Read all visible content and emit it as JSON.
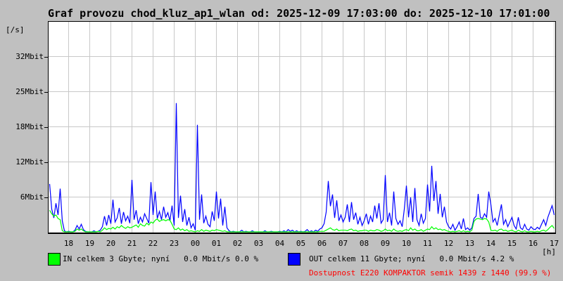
{
  "title": "Graf provozu chod_kluz_ap1_wlan od: 2025-12-09 17:03:00 do: 2025-12-10 17:01:00",
  "y_unit_label": "[/s]",
  "x_unit_label": "[h]",
  "legend": {
    "in": {
      "color": "#00ff00",
      "label": "IN celkem 3 Gbyte; nyní   0.0 Mbit/s 0.0 %"
    },
    "out": {
      "color": "#0000ff",
      "label": "OUT celkem 11 Gbyte; nyní   0.0 Mbit/s 4.2 %"
    },
    "availability": {
      "color": "#ff0000",
      "label": "Dostupnost E220 KOMPAKTOR semik 1439 z 1440 (99.9 %)"
    }
  },
  "chart_data": {
    "type": "line",
    "title": "Graf provozu chod_kluz_ap1_wlan",
    "time_start": "2025-12-09 17:03:00",
    "time_end": "2025-12-10 17:01:00",
    "xlabel": "[h]",
    "ylabel": "[/s]",
    "grid": true,
    "sample_interval_min": 6,
    "unit": "Mbit/s",
    "ylim_mbit": [
      0,
      36
    ],
    "y_tick_labels": [
      "32Mbit",
      "25Mbit",
      "18Mbit",
      "12Mbit",
      "6Mbit"
    ],
    "y_tick_values_mbit": [
      30,
      24,
      18,
      12,
      6
    ],
    "x_tick_labels": [
      "18",
      "19",
      "20",
      "21",
      "22",
      "23",
      "00",
      "01",
      "02",
      "03",
      "04",
      "05",
      "06",
      "07",
      "08",
      "09",
      "10",
      "11",
      "12",
      "13",
      "14",
      "15",
      "16",
      "17"
    ],
    "series": [
      {
        "name": "OUT",
        "color": "#0000ff",
        "values": [
          8.3,
          4.0,
          2.5,
          5.0,
          3.0,
          7.5,
          2.0,
          0.3,
          0.1,
          0.2,
          0.1,
          0.1,
          0.4,
          1.2,
          0.6,
          1.4,
          0.5,
          0.2,
          0.1,
          0.1,
          0.1,
          0.3,
          0.1,
          0.2,
          0.4,
          1.0,
          2.8,
          1.2,
          3.0,
          1.5,
          5.6,
          1.8,
          2.5,
          4.2,
          1.5,
          3.5,
          2.0,
          2.8,
          1.6,
          9.0,
          2.2,
          3.8,
          1.5,
          2.6,
          1.8,
          3.2,
          2.4,
          1.6,
          8.6,
          3.0,
          7.0,
          2.4,
          3.6,
          2.2,
          4.4,
          2.6,
          3.4,
          2.0,
          4.6,
          1.2,
          22.1,
          2.5,
          6.3,
          1.8,
          4.0,
          1.2,
          2.6,
          0.8,
          1.5,
          0.4,
          18.4,
          2.2,
          6.5,
          1.6,
          2.8,
          1.4,
          1.0,
          3.6,
          2.0,
          7.0,
          2.4,
          5.8,
          1.2,
          4.4,
          0.8,
          0.3,
          0.1,
          0.2,
          0.1,
          0.1,
          0.1,
          0.4,
          0.1,
          0.2,
          0.1,
          0.1,
          0.3,
          0.1,
          0.1,
          0.1,
          0.1,
          0.1,
          0.3,
          0.1,
          0.1,
          0.2,
          0.1,
          0.1,
          0.1,
          0.2,
          0.1,
          0.3,
          0.1,
          0.5,
          0.2,
          0.4,
          0.1,
          0.3,
          0.1,
          0.2,
          0.1,
          0.2,
          0.5,
          0.1,
          0.3,
          0.1,
          0.4,
          0.2,
          0.6,
          0.8,
          1.5,
          3.5,
          8.8,
          4.5,
          6.5,
          2.5,
          5.5,
          2.0,
          3.0,
          1.8,
          2.6,
          4.8,
          1.8,
          5.2,
          2.2,
          3.4,
          1.4,
          2.6,
          1.2,
          2.0,
          3.2,
          1.4,
          2.8,
          1.8,
          4.6,
          2.4,
          5.0,
          1.6,
          2.2,
          9.8,
          1.8,
          3.4,
          1.2,
          7.0,
          2.4,
          1.4,
          2.0,
          1.0,
          4.0,
          8.0,
          2.6,
          6.0,
          1.8,
          7.6,
          2.2,
          1.2,
          3.2,
          1.6,
          2.4,
          8.2,
          3.6,
          11.4,
          5.4,
          8.8,
          3.2,
          6.6,
          2.6,
          4.4,
          1.8,
          1.0,
          0.6,
          1.4,
          0.4,
          1.0,
          1.8,
          0.6,
          2.4,
          0.5,
          0.8,
          0.4,
          0.8,
          2.4,
          2.8,
          6.6,
          2.6,
          2.4,
          3.2,
          2.6,
          7.0,
          4.8,
          1.8,
          2.4,
          1.2,
          3.0,
          4.8,
          1.4,
          2.2,
          1.0,
          1.8,
          2.6,
          1.2,
          0.6,
          2.6,
          0.8,
          0.5,
          1.4,
          0.6,
          0.4,
          1.0,
          0.6,
          0.5,
          0.9,
          0.6,
          1.4,
          2.2,
          1.2,
          2.6,
          3.6,
          4.6,
          3.0
        ]
      },
      {
        "name": "IN",
        "color": "#00ff00",
        "values": [
          3.8,
          3.2,
          2.8,
          3.0,
          2.4,
          2.2,
          0.3,
          0.1,
          0.1,
          0.1,
          0.1,
          0.1,
          0.2,
          0.6,
          0.4,
          0.6,
          0.3,
          0.1,
          0.1,
          0.1,
          0.1,
          0.1,
          0.1,
          0.2,
          0.1,
          0.4,
          0.8,
          0.5,
          0.7,
          0.6,
          0.9,
          0.6,
          1.0,
          0.8,
          1.2,
          0.9,
          0.7,
          1.0,
          0.8,
          0.9,
          1.1,
          1.3,
          0.9,
          1.5,
          1.2,
          1.1,
          1.6,
          1.3,
          1.8,
          1.6,
          2.1,
          2.3,
          1.9,
          2.1,
          2.2,
          2.0,
          2.2,
          2.1,
          1.4,
          0.6,
          0.5,
          0.8,
          0.4,
          0.6,
          0.3,
          0.5,
          0.2,
          0.3,
          0.2,
          0.1,
          0.3,
          0.2,
          0.5,
          0.2,
          0.4,
          0.3,
          0.2,
          0.4,
          0.3,
          0.5,
          0.4,
          0.3,
          0.2,
          0.3,
          0.1,
          0.1,
          0.1,
          0.1,
          0.1,
          0.1,
          0.05,
          0.1,
          0.05,
          0.05,
          0.1,
          0.05,
          0.05,
          0.1,
          0.05,
          0.05,
          0.05,
          0.05,
          0.1,
          0.05,
          0.05,
          0.05,
          0.1,
          0.05,
          0.05,
          0.05,
          0.05,
          0.1,
          0.05,
          0.1,
          0.05,
          0.05,
          0.1,
          0.05,
          0.1,
          0.05,
          0.05,
          0.05,
          0.1,
          0.05,
          0.1,
          0.05,
          0.1,
          0.1,
          0.2,
          0.2,
          0.2,
          0.4,
          0.6,
          0.8,
          0.5,
          0.4,
          0.6,
          0.3,
          0.4,
          0.4,
          0.4,
          0.3,
          0.5,
          0.6,
          0.3,
          0.4,
          0.2,
          0.3,
          0.3,
          0.4,
          0.4,
          0.2,
          0.4,
          0.3,
          0.3,
          0.5,
          0.4,
          0.2,
          0.3,
          0.6,
          0.3,
          0.4,
          0.2,
          0.6,
          0.3,
          0.2,
          0.3,
          0.2,
          0.4,
          0.5,
          0.3,
          0.8,
          0.4,
          0.6,
          0.3,
          0.3,
          0.5,
          0.2,
          0.4,
          0.6,
          0.5,
          1.0,
          0.6,
          0.8,
          0.5,
          0.6,
          0.4,
          0.5,
          0.3,
          0.2,
          0.1,
          0.2,
          0.1,
          0.2,
          0.3,
          0.1,
          0.3,
          0.1,
          0.2,
          0.1,
          0.4,
          1.9,
          2.3,
          2.4,
          2.3,
          2.2,
          2.4,
          2.3,
          1.8,
          0.4,
          0.3,
          0.4,
          0.2,
          0.5,
          0.6,
          0.3,
          0.4,
          0.2,
          0.3,
          0.4,
          0.2,
          0.1,
          0.4,
          0.2,
          0.1,
          0.3,
          0.1,
          0.1,
          0.2,
          0.1,
          0.1,
          0.2,
          0.1,
          0.3,
          0.4,
          0.2,
          0.5,
          0.9,
          1.2,
          0.7
        ]
      }
    ]
  }
}
